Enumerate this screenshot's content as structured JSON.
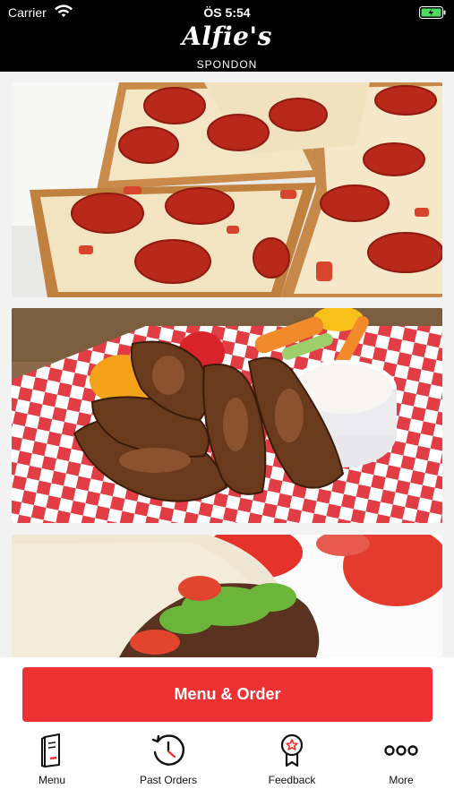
{
  "status_bar": {
    "carrier": "Carrier",
    "time": "ÖS 5:54"
  },
  "header": {
    "brand": "Alfie's",
    "location": "SPONDON"
  },
  "tiles": [
    {
      "icon": "pizza-image"
    },
    {
      "icon": "chicken-wings-image"
    },
    {
      "icon": "kebab-wrap-image"
    }
  ],
  "cta": {
    "label": "Menu & Order"
  },
  "tabbar": {
    "items": [
      {
        "label": "Menu",
        "icon": "menu-book-icon"
      },
      {
        "label": "Past Orders",
        "icon": "history-clock-icon"
      },
      {
        "label": "Feedback",
        "icon": "award-badge-icon"
      },
      {
        "label": "More",
        "icon": "more-dots-icon"
      }
    ]
  },
  "colors": {
    "accent": "#ee3234",
    "header_bg": "#000000"
  }
}
